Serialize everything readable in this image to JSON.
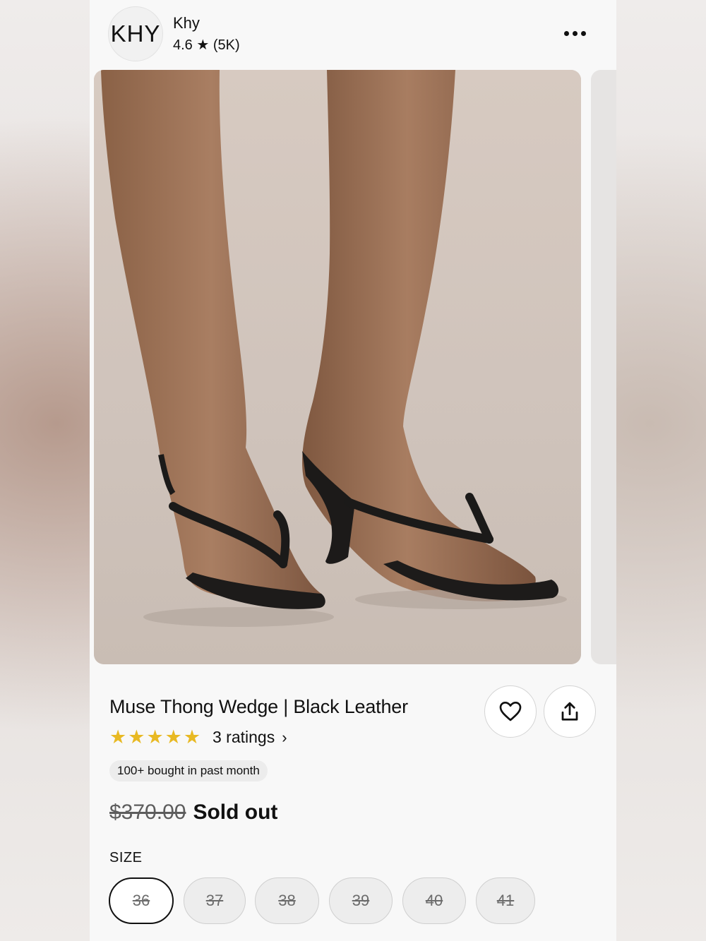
{
  "header": {
    "logo_text": "KHY",
    "shop_name": "Khy",
    "shop_rating": "4.6 ★ (5K)"
  },
  "product": {
    "title": "Muse Thong Wedge | Black Leather",
    "stars": [
      "★",
      "★",
      "★",
      "★",
      "★"
    ],
    "rating_value": 5,
    "ratings_text": "3 ratings",
    "ratings_chevron": "›",
    "badge": "100+ bought in past month",
    "original_price": "$370.00",
    "status": "Sold out"
  },
  "size": {
    "label": "SIZE",
    "options": [
      "36",
      "37",
      "38",
      "39",
      "40",
      "41"
    ],
    "selected": "36"
  },
  "icons": {
    "more": "more-horizontal-icon",
    "favorite": "heart-icon",
    "share": "share-icon",
    "star_color": "#e8b923"
  }
}
